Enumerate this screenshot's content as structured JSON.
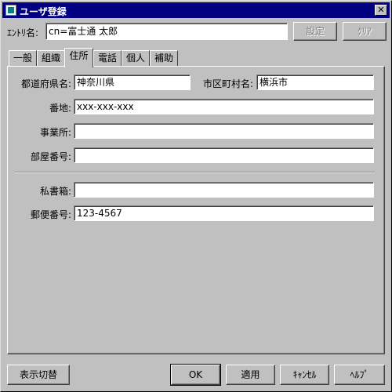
{
  "window": {
    "title": "ユーザ登録",
    "close_glyph": "✕"
  },
  "entry": {
    "label": "ｴﾝﾄﾘ名:",
    "value": "cn=富士通 太郎"
  },
  "top_buttons": {
    "set": "設定",
    "clear": "ｸﾘｱ"
  },
  "tabs": [
    {
      "label": "一般"
    },
    {
      "label": "組織"
    },
    {
      "label": "住所"
    },
    {
      "label": "電話"
    },
    {
      "label": "個人"
    },
    {
      "label": "補助"
    }
  ],
  "active_tab": "住所",
  "form": {
    "prefecture": {
      "label": "都道府県名:",
      "value": "神奈川県"
    },
    "city": {
      "label": "市区町村名:",
      "value": "横浜市"
    },
    "address": {
      "label": "番地:",
      "value": "xxx-xxx-xxx"
    },
    "office": {
      "label": "事業所:",
      "value": ""
    },
    "room": {
      "label": "部屋番号:",
      "value": ""
    },
    "pobox": {
      "label": "私書箱:",
      "value": ""
    },
    "postal": {
      "label": "郵便番号:",
      "value": "123-4567"
    }
  },
  "bottom_buttons": {
    "toggle_view": "表示切替",
    "ok": "OK",
    "apply": "適用",
    "cancel": "ｷｬﾝｾﾙ",
    "help": "ﾍﾙﾌﾟ"
  }
}
